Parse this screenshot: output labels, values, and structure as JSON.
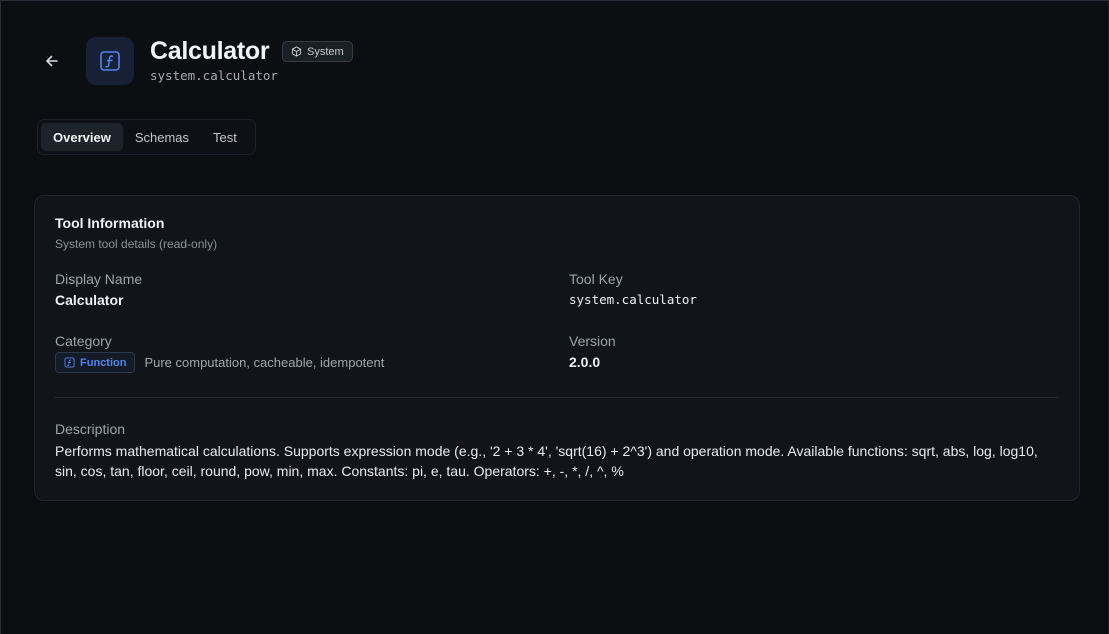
{
  "header": {
    "title": "Calculator",
    "badge": "System",
    "key": "system.calculator"
  },
  "tabs": [
    {
      "label": "Overview",
      "active": true
    },
    {
      "label": "Schemas",
      "active": false
    },
    {
      "label": "Test",
      "active": false
    }
  ],
  "card": {
    "title": "Tool Information",
    "subtitle": "System tool details (read-only)",
    "display_name_label": "Display Name",
    "display_name": "Calculator",
    "tool_key_label": "Tool Key",
    "tool_key": "system.calculator",
    "category_label": "Category",
    "category_badge": "Function",
    "category_desc": "Pure computation, cacheable, idempotent",
    "version_label": "Version",
    "version": "2.0.0",
    "description_label": "Description",
    "description": "Performs mathematical calculations. Supports expression mode (e.g., '2 + 3 * 4', 'sqrt(16) + 2^3') and operation mode. Available functions: sqrt, abs, log, log10, sin, cos, tan, floor, ceil, round, pow, min, max. Constants: pi, e, tau. Operators: +, -, *, /, ^, %"
  },
  "icons": {
    "back": "arrow-left-icon",
    "app": "function-icon",
    "system": "cube-icon",
    "category": "function-icon"
  },
  "colors": {
    "background": "#0c0e12",
    "card": "#111419",
    "accent": "#4f86ee"
  }
}
